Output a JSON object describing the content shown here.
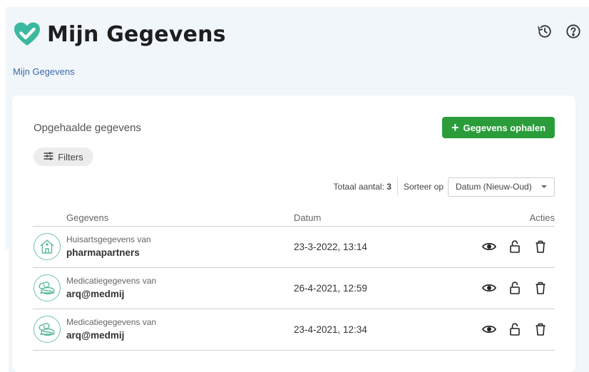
{
  "header": {
    "title": "Mijn Gegevens",
    "logo_icon": "heart-check-icon",
    "brand_color": "#3bb8a0",
    "actions": [
      {
        "icon": "history-icon"
      },
      {
        "icon": "help-icon"
      }
    ]
  },
  "breadcrumb": {
    "label": "Mijn Gegevens"
  },
  "card": {
    "section_title": "Opgehaalde gegevens",
    "primary_button": {
      "label": "Gegevens ophalen",
      "icon": "plus-icon",
      "color": "#2a9d3a"
    },
    "filters": {
      "label": "Filters",
      "icon": "sliders-icon"
    },
    "total": {
      "label": "Totaal aantal:",
      "value": "3"
    },
    "sort": {
      "label": "Sorteer op",
      "selected": "Datum (Nieuw-Oud)"
    }
  },
  "table": {
    "columns": {
      "gegevens": "Gegevens",
      "datum": "Datum",
      "acties": "Acties"
    },
    "rows": [
      {
        "icon": "house-icon",
        "subtitle": "Huisartsgegevens van",
        "name": "pharmapartners",
        "date": "23-3-2022, 13:14"
      },
      {
        "icon": "pills-icon",
        "subtitle": "Medicatiegegevens van",
        "name": "arq@medmij",
        "date": "26-4-2021, 12:59"
      },
      {
        "icon": "pills-icon",
        "subtitle": "Medicatiegegevens van",
        "name": "arq@medmij",
        "date": "23-4-2021, 12:34"
      }
    ],
    "row_actions": [
      "eye-icon",
      "lock-icon",
      "trash-icon"
    ]
  }
}
